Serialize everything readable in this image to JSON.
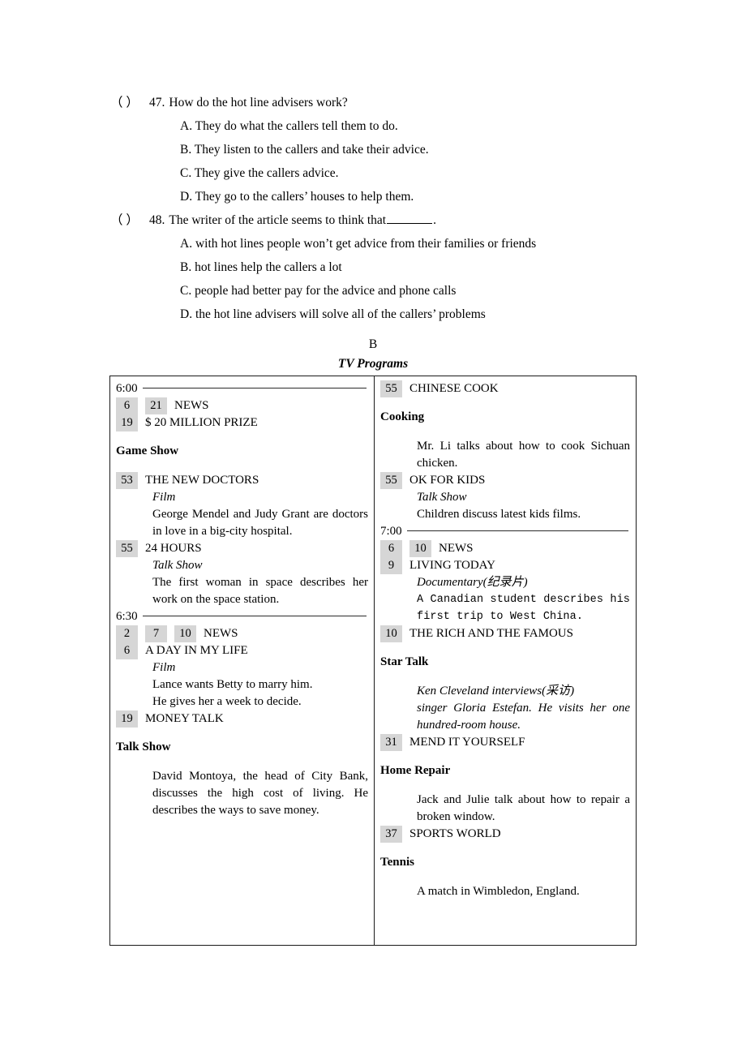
{
  "questions": [
    {
      "paren": "（    ）",
      "number": "47.",
      "stem": "How do the hot line advisers work?",
      "has_blank": false,
      "stem_tail": "",
      "options": [
        "A. They do what the callers tell them to do.",
        "B. They listen to the callers and take their advice.",
        "C. They give the callers advice.",
        "D. They go to the callers’ houses to help them."
      ]
    },
    {
      "paren": "（    ）",
      "number": "48.",
      "stem": "The writer of the article seems to think that",
      "has_blank": true,
      "stem_tail": ".",
      "options": [
        "A. with hot lines people won’t get advice from their families or friends",
        "B. hot lines help the callers a lot",
        "C. people had better pay for the advice and phone calls",
        "D. the hot line advisers will solve all of the callers’ problems"
      ]
    }
  ],
  "section": {
    "letter": "B",
    "title": "TV Programs"
  },
  "tv_table": {
    "left_column": {
      "time_1": "6:00",
      "entry_1": {
        "channels_stacked": [
          "6",
          "19"
        ],
        "line_1_inline_channel": "21",
        "line_1_program": "NEWS",
        "line_2_program": "$ 20 MILLION PRIZE",
        "genre_heading": "Game Show"
      },
      "entry_2": {
        "channel": "53",
        "program": "THE NEW DOCTORS",
        "genre": "Film",
        "description": "George Mendel and Judy Grant are doctors in love in a big-city hospital."
      },
      "entry_3": {
        "channel": "55",
        "program": "24 HOURS",
        "genre": "Talk Show",
        "description": "The first woman in space describes her work on the space station."
      },
      "time_2": "6:30",
      "entry_4": {
        "channels_stacked": [
          "2",
          "6"
        ],
        "line_1_inline_channels": [
          "7",
          "10"
        ],
        "line_1_program": "NEWS",
        "line_2_program": "A DAY IN MY LIFE",
        "genre": "Film",
        "description_line_1": "Lance wants Betty to marry him.",
        "description_line_2": "He gives her a week to decide."
      },
      "entry_5": {
        "channel": "19",
        "program": "MONEY TALK",
        "genre_heading": "Talk Show",
        "description": "David Montoya, the head of City Bank, discusses the high cost of living. He describes the ways to save money."
      }
    },
    "right_column": {
      "entry_1": {
        "channel": "55",
        "program": "CHINESE COOK",
        "genre_heading": "Cooking",
        "description": "Mr. Li talks about how to cook Sichuan chicken."
      },
      "entry_2": {
        "channel": "55",
        "program": "OK FOR KIDS",
        "genre": "Talk Show",
        "description": "Children discuss latest kids films."
      },
      "time_1": "7:00",
      "entry_3": {
        "channels_stacked": [
          "6",
          "9"
        ],
        "line_1_inline_channel": "10",
        "line_1_program": "NEWS",
        "line_2_program": "LIVING TODAY",
        "genre": "Documentary(纪录片)",
        "description": "A Canadian student describes his first trip to West China."
      },
      "entry_4": {
        "channel": "10",
        "program": "THE RICH AND THE FAMOUS",
        "genre_heading": "Star Talk",
        "description_line_1": "Ken Cleveland interviews(采访)",
        "description_line_2": "singer Gloria Estefan.  He visits her one hundred-room house."
      },
      "entry_5": {
        "channel": "31",
        "program": "MEND IT YOURSELF",
        "genre_heading": "Home Repair",
        "description": "Jack and Julie talk about how to repair a broken window."
      },
      "entry_6": {
        "channel": "37",
        "program": "SPORTS WORLD",
        "genre_heading": "Tennis",
        "description": "A match in Wimbledon, England."
      }
    }
  },
  "colors": {
    "channel_badge_bg": "#d6d6d6",
    "border": "#1a1a1a",
    "text": "#000000"
  }
}
